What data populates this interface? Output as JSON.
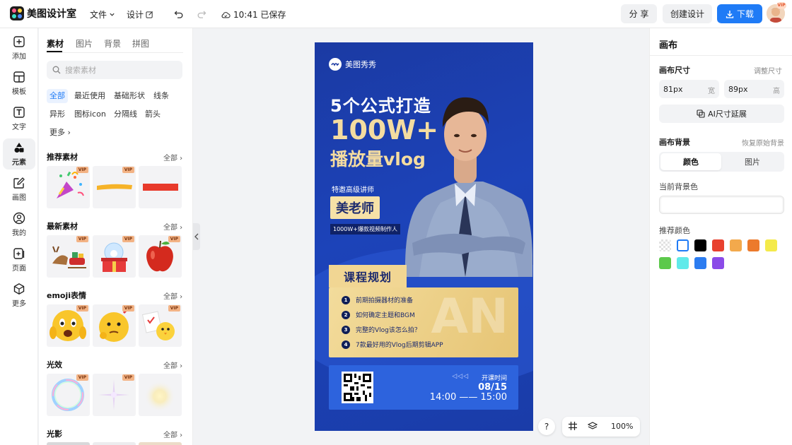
{
  "app": {
    "name": "美图设计室"
  },
  "header": {
    "menus": [
      {
        "label": "文件"
      },
      {
        "label": "设计"
      }
    ],
    "saved_status": "10:41 已保存",
    "share_label": "分 享",
    "create_label": "创建设计",
    "download_label": "下载",
    "vip_label": "VIP"
  },
  "rail": {
    "items": [
      {
        "label": "添加",
        "icon": "plus-square-icon"
      },
      {
        "label": "模板",
        "icon": "template-icon"
      },
      {
        "label": "文字",
        "icon": "text-icon"
      },
      {
        "label": "元素",
        "icon": "shapes-icon"
      },
      {
        "label": "画图",
        "icon": "edit-icon"
      },
      {
        "label": "我的",
        "icon": "user-icon"
      },
      {
        "label": "页面",
        "icon": "page-add-icon"
      },
      {
        "label": "更多",
        "icon": "cube-icon"
      }
    ],
    "active_index": 3
  },
  "panel": {
    "tabs": [
      {
        "label": "素材"
      },
      {
        "label": "图片"
      },
      {
        "label": "背景"
      },
      {
        "label": "拼图"
      }
    ],
    "search_placeholder": "搜索素材",
    "chips": [
      {
        "label": "全部"
      },
      {
        "label": "最近使用"
      },
      {
        "label": "基础形状"
      },
      {
        "label": "线条"
      },
      {
        "label": "异形"
      },
      {
        "label": "图标icon"
      },
      {
        "label": "分隔线"
      },
      {
        "label": "箭头"
      },
      {
        "label": "更多"
      }
    ],
    "all_label": "全部",
    "vip_label": "VIP",
    "sections": [
      {
        "title": "推荐素材"
      },
      {
        "title": "最新素材"
      },
      {
        "title": "emoji表情"
      },
      {
        "title": "光效"
      },
      {
        "title": "光影"
      }
    ]
  },
  "poster": {
    "brand": "美图秀秀",
    "title_line1": "5个公式打造",
    "title_line2": "100W+",
    "title_line3": "播放量vlog",
    "speaker_tag": "特邀高级讲师",
    "speaker_name": "美老师",
    "speaker_desc": "1000W+爆款视频制作人",
    "course_title": "课程规划",
    "course_bg_text": "AN",
    "course_items": [
      {
        "num": "1",
        "text": "前期拍摄器材的准备"
      },
      {
        "num": "2",
        "text": "如何确定主题和BGM"
      },
      {
        "num": "3",
        "text": "完整的Vlog该怎么拍？"
      },
      {
        "num": "4",
        "text": "7款最好用的Vlog后期剪辑APP"
      }
    ],
    "arrows": "◁◁◁",
    "open_label": "开课时间",
    "open_date": "08/15",
    "open_time": "14:00 —— 15:00"
  },
  "canvas_controls": {
    "help": "?",
    "zoom": "100%"
  },
  "right": {
    "title": "画布",
    "size_label": "画布尺寸",
    "adjust_label": "调整尺寸",
    "width_value": "81px",
    "width_unit": "宽",
    "height_value": "89px",
    "height_unit": "高",
    "ai_label": "AI尺寸延展",
    "bg_label": "画布背景",
    "restore_label": "恢复原始背景",
    "seg_color": "颜色",
    "seg_image": "图片",
    "current_bg_label": "当前背景色",
    "recommend_label": "推荐颜色",
    "swatches": [
      "transparent",
      "#ffffff",
      "#000000",
      "#e8412f",
      "#f3a94c",
      "#ec7a2c",
      "#f4ea4a",
      "#5cc94b",
      "#60eaea",
      "#2c7cf0",
      "#8b4be8"
    ]
  },
  "colors": {
    "accent": "#1f7bf6",
    "poster_blue": "#1c43b9",
    "gold": "#f1d693"
  }
}
